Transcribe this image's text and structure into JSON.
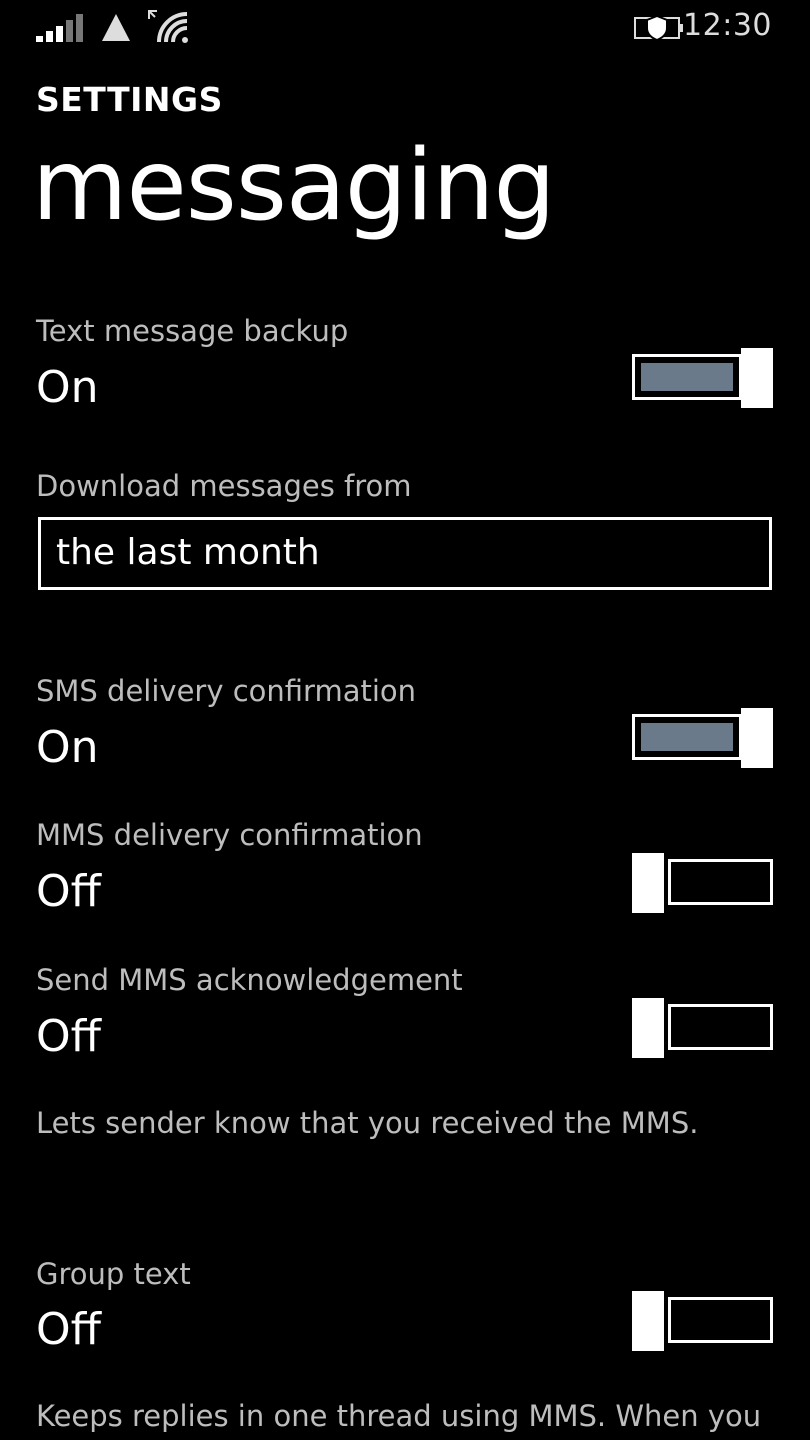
{
  "status_bar": {
    "icons": [
      "signal-strength-icon",
      "network-triangle-icon",
      "wifi-icon",
      "battery-saver-icon"
    ],
    "time": "12:30"
  },
  "header": {
    "breadcrumb": "SETTINGS",
    "title": "messaging"
  },
  "settings": {
    "text_backup": {
      "label": "Text message backup",
      "state": "On",
      "on": true
    },
    "download_from": {
      "label": "Download messages from",
      "value": "the last month"
    },
    "sms_confirmation": {
      "label": "SMS delivery confirmation",
      "state": "On",
      "on": true
    },
    "mms_confirmation": {
      "label": "MMS delivery confirmation",
      "state": "Off",
      "on": false
    },
    "mms_ack": {
      "label": "Send MMS acknowledgement",
      "state": "Off",
      "on": false,
      "hint": "Lets sender know that you received the MMS."
    },
    "group_text": {
      "label": "Group text",
      "state": "Off",
      "on": false,
      "hint": "Keeps replies in one thread using MMS. When you"
    }
  },
  "colors": {
    "background": "#000000",
    "toggle_fill": "#6b7a8b",
    "label": "#bdbdbd"
  }
}
